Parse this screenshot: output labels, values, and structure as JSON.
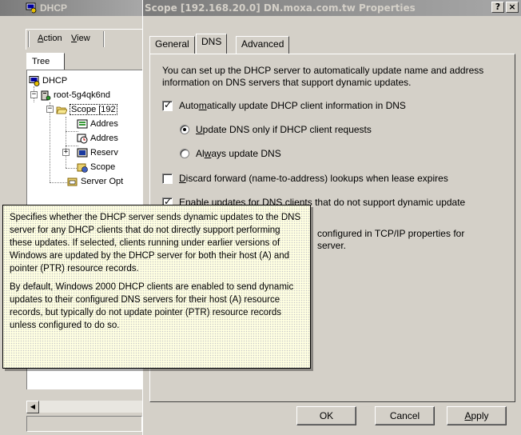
{
  "mmc": {
    "title": "DHCP",
    "menu": {
      "action": "Action",
      "view": "View"
    },
    "tree_tab": "Tree",
    "tree": [
      {
        "label": "DHCP"
      },
      {
        "label": "root-5g4qk6nd"
      },
      {
        "label": "Scope [192"
      },
      {
        "label": "Addres"
      },
      {
        "label": "Addres"
      },
      {
        "label": "Reserv"
      },
      {
        "label": "Scope"
      },
      {
        "label": "Server Opt"
      }
    ]
  },
  "dialog": {
    "title": "Scope [192.168.20.0] DN.moxa.com.tw Properties",
    "help_btn": "?",
    "close_btn": "×",
    "tabs": [
      "General",
      "DNS",
      "Advanced"
    ],
    "intro": "You can set up the DHCP server to automatically update name and address information on DNS servers that support dynamic updates.",
    "auto_update": {
      "pre": "Auto",
      "u": "m",
      "post": "atically update DHCP client information in DNS"
    },
    "radio_on_request": {
      "pre": "",
      "u": "U",
      "post": "pdate DNS only if DHCP client requests"
    },
    "radio_always": {
      "pre": "Al",
      "u": "w",
      "post": "ays update DNS"
    },
    "discard_lookups": {
      "pre": "",
      "u": "D",
      "post": "iscard forward (name-to-address) lookups when lease expires"
    },
    "enable_updates": {
      "text": "Enable updates for DNS clients that do not support dynamic update"
    },
    "partial_line1": "configured in TCP/IP properties for",
    "partial_line2": "server.",
    "buttons": {
      "ok": "OK",
      "cancel": "Cancel",
      "apply_u": "A",
      "apply_rest": "pply"
    }
  },
  "tooltip": {
    "para1": "Specifies whether the DHCP server sends dynamic updates to the DNS server for any DHCP clients that do not directly support performing these updates. If selected, clients running under earlier versions of Windows are updated by the DHCP server for both their host (A) and pointer (PTR) resource records.",
    "para2": "By default, Windows 2000 DHCP clients are enabled to send dynamic updates to their configured DNS servers for their host (A) resource records, but typically do not update pointer (PTR) resource records unless configured to do so."
  }
}
